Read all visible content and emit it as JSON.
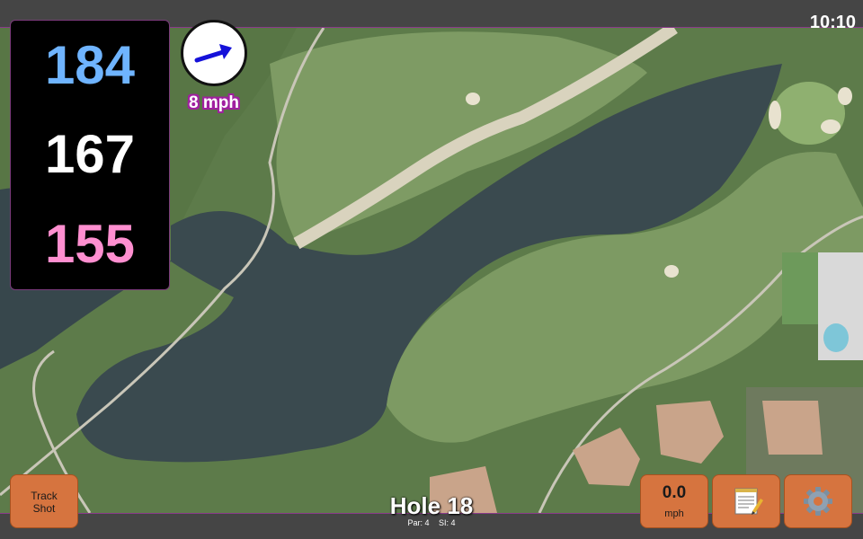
{
  "clock": "10:10",
  "yardage": {
    "back": "184",
    "middle": "167",
    "front": "155"
  },
  "wind": {
    "speed_label": "8 mph",
    "direction_icon": "arrow-right-up-icon"
  },
  "buttons": {
    "track_shot_line1": "Track",
    "track_shot_line2": "Shot",
    "speed_value": "0.0",
    "speed_unit": "mph",
    "notes_icon": "notepad-icon",
    "settings_icon": "gear-icon"
  },
  "hole": {
    "title": "Hole 18",
    "par": "Par: 4",
    "si": "SI: 4"
  },
  "colors": {
    "back_yardage": "#6fb4ff",
    "middle_yardage": "#ffffff",
    "front_yardage": "#ff8fd0",
    "button_bg": "#d6743f",
    "wind_accent": "#a020a0"
  }
}
